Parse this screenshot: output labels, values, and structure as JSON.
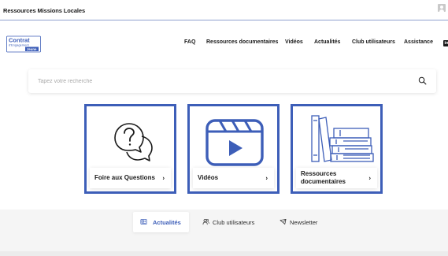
{
  "window": {
    "title": "Ressources Missions Locales"
  },
  "logo": {
    "line1": "Contrat",
    "line2": "d'Engagement",
    "badge": "Jeune"
  },
  "nav": {
    "items": [
      {
        "label": "FAQ"
      },
      {
        "label": "Ressources documentaires"
      },
      {
        "label": "Vidéos"
      },
      {
        "label": "Actualités"
      },
      {
        "label": "Club utilisateurs"
      },
      {
        "label": "Assistance"
      }
    ],
    "social_icon": "linkedin-icon",
    "social_text": "in"
  },
  "search": {
    "placeholder": "Tapez votre recherche",
    "value": ""
  },
  "cards": [
    {
      "label": "Foire aux Questions",
      "icon": "question-bubbles-icon"
    },
    {
      "label": "Vidéos",
      "icon": "video-play-icon"
    },
    {
      "label_line1": "Ressources",
      "label_line2": "documentaires",
      "icon": "books-icon"
    }
  ],
  "chevron": "›",
  "tabs": [
    {
      "label": "Actualités",
      "icon": "news-icon",
      "active": true
    },
    {
      "label": "Club utilisateurs",
      "icon": "users-icon",
      "active": false
    },
    {
      "label": "Newsletter",
      "icon": "mail-icon",
      "active": false
    }
  ],
  "colors": {
    "accent": "#3d5eb8",
    "text": "#1a1a1a",
    "bottom_bg": "#f5f5f5"
  }
}
